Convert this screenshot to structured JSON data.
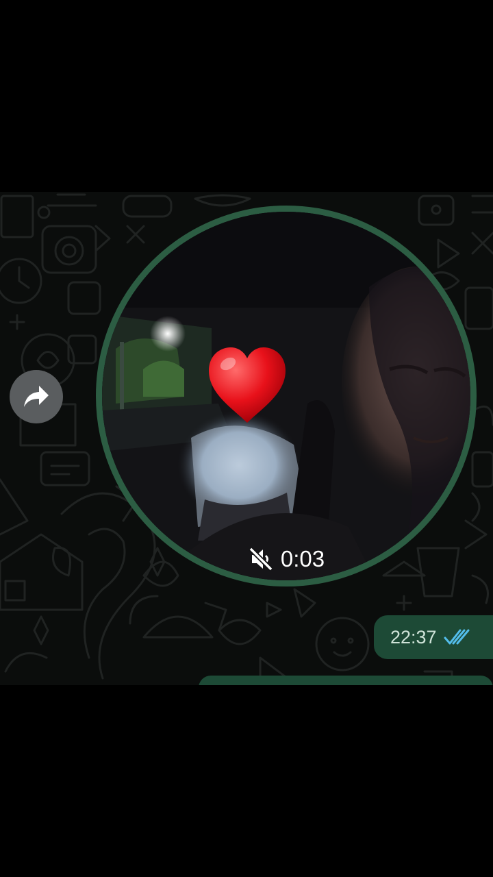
{
  "message": {
    "video_note": {
      "duration": "0:03",
      "muted_icon": "volume-muted-icon",
      "reaction_icon": "red-heart-icon"
    },
    "timestamp": "22:37",
    "read_receipt_icon": "double-check-icon"
  },
  "actions": {
    "forward_icon": "share-arrow-icon"
  },
  "colors": {
    "outgoing_bubble": "#1d4a36",
    "video_ring": "#2c5d43",
    "read_check": "#53bdeb"
  }
}
